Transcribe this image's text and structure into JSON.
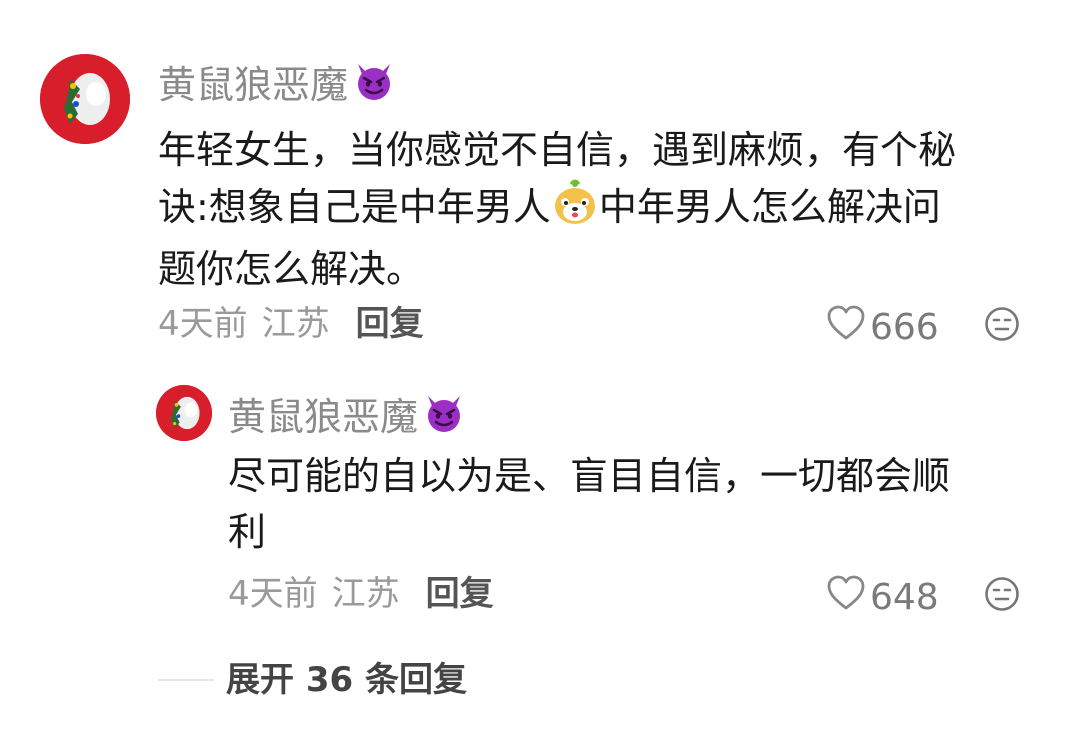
{
  "comments": [
    {
      "username": "黄鼠狼恶魔",
      "text_line1": "年轻女生，当你感觉不自信，遇到麻烦，有个秘",
      "text_line2a": "诀:想象自己是中年男人",
      "text_line2b": "中年男人怎么解决问",
      "text_line3": "题你怎么解决。",
      "time": "4天前",
      "location": "江苏",
      "reply_label": "回复",
      "likes": "666"
    },
    {
      "username": "黄鼠狼恶魔",
      "text_line1": "尽可能的自以为是、盲目自信，一切都会顺",
      "text_line2": "利",
      "time": "4天前",
      "location": "江苏",
      "reply_label": "回复",
      "likes": "648"
    }
  ],
  "expand_label": "展开 36 条回复",
  "icons": {
    "devil": "smiling-devil-emoji",
    "inline_emoji": "cute-dog-emoji",
    "like": "heart-outline-icon",
    "dislike": "neutral-face-icon"
  },
  "colors": {
    "avatar_bg": "#d81e2a",
    "devil_purple": "#9b2fc4",
    "username_gray": "#8a8a8a",
    "text": "#1a1a1a"
  }
}
